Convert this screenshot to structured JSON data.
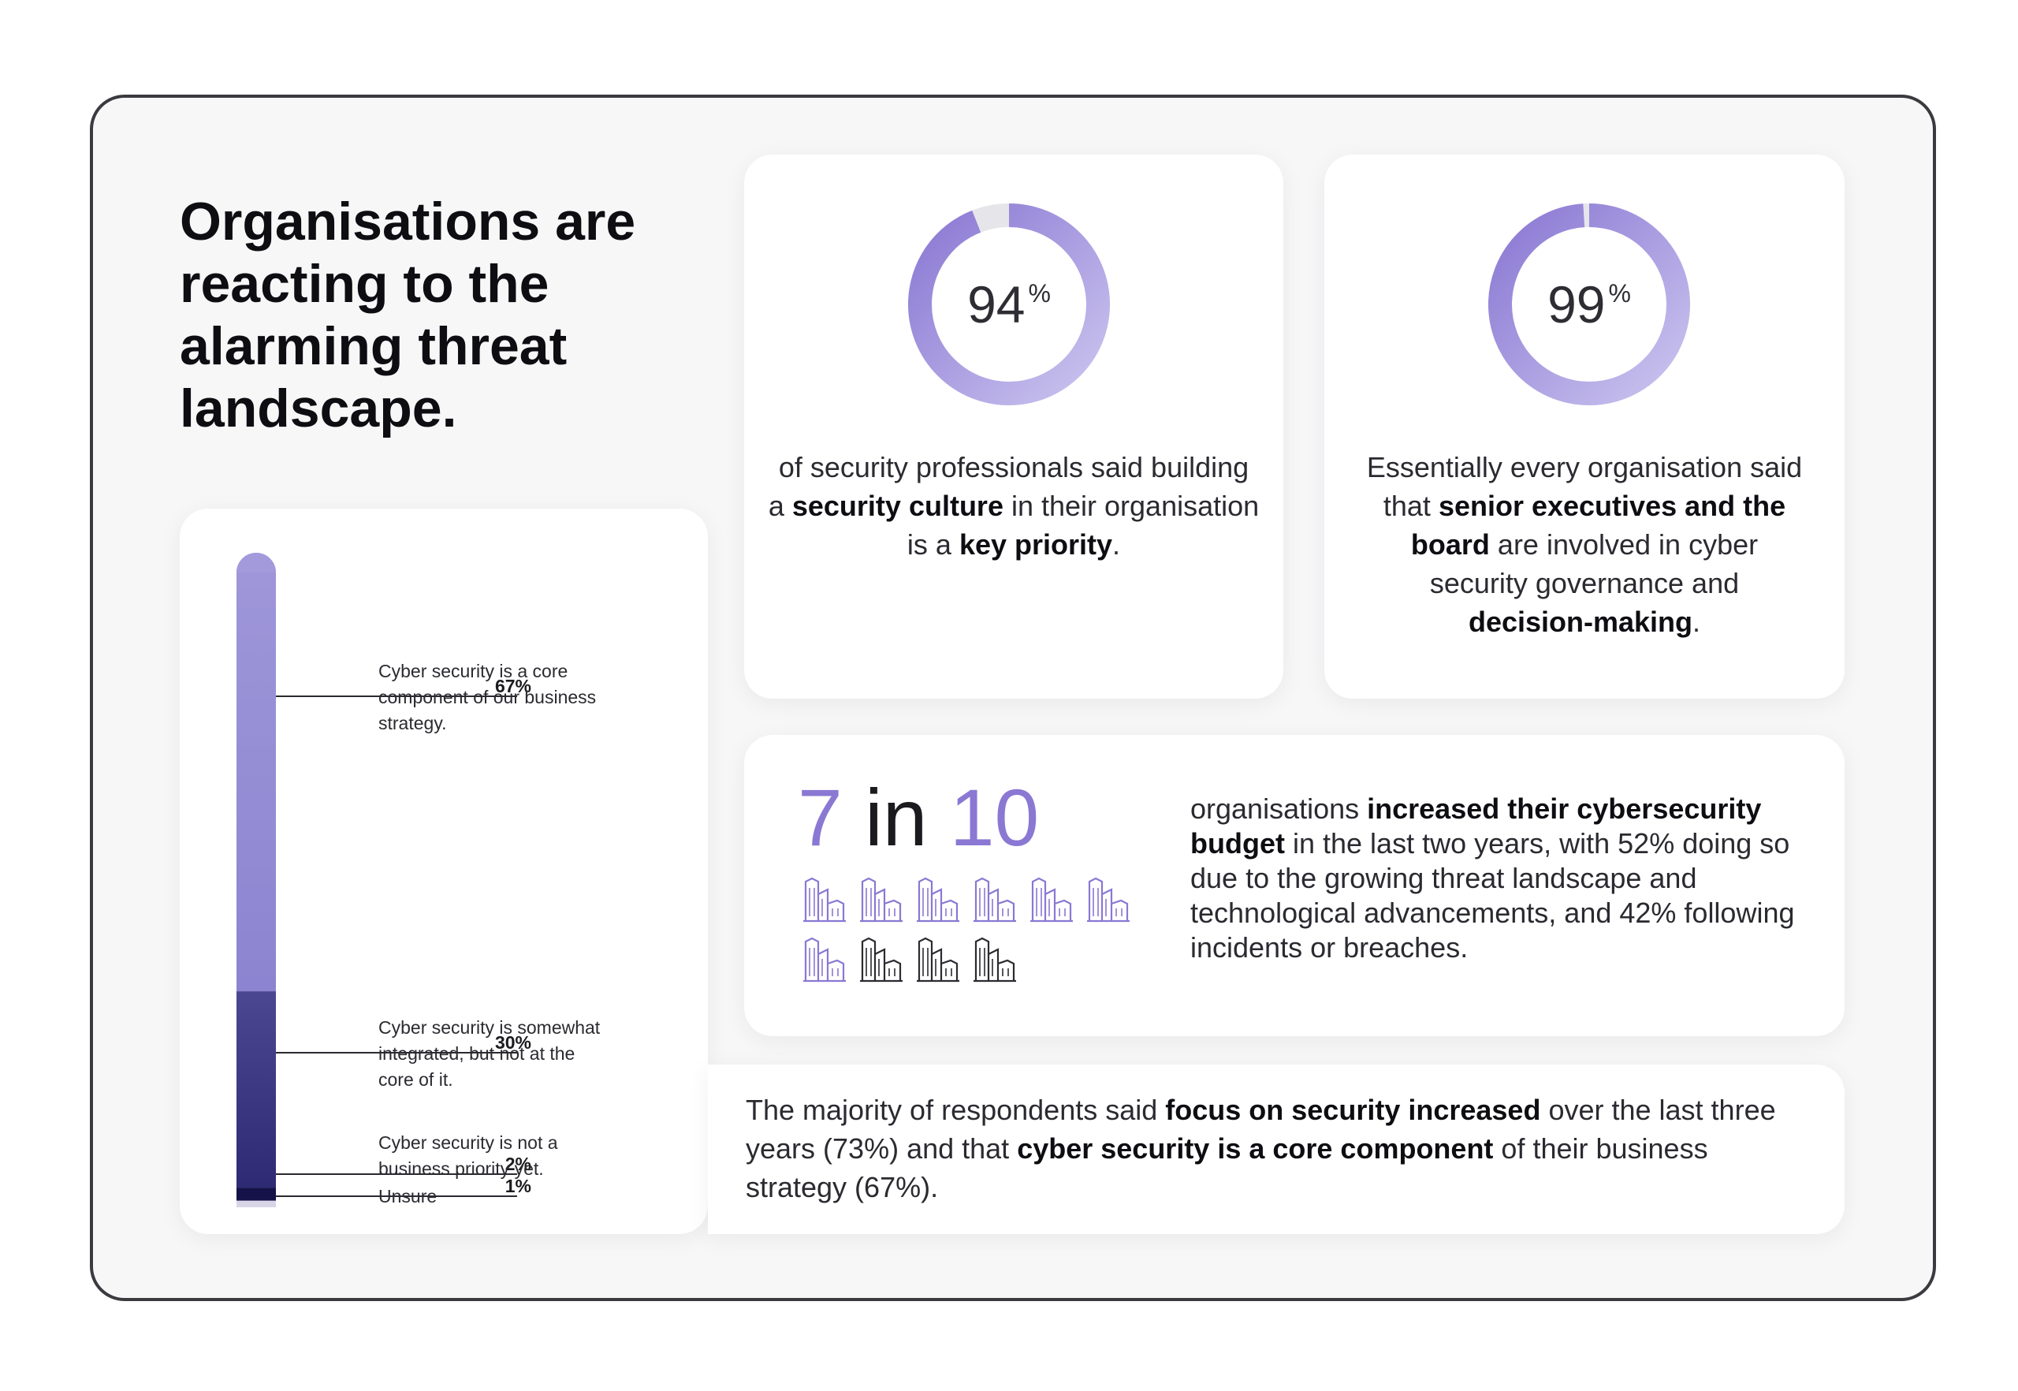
{
  "headline": "Organisations are reacting to the alarming threat landscape.",
  "colors": {
    "light_purple": "#9a90d6",
    "mid_indigo": "#3e3a86",
    "dark_navy": "#15124a",
    "unsure_gray": "#d8d6e6",
    "donut_track": "#e6e6ea",
    "accent": "#8a78d3"
  },
  "chart_data": [
    {
      "type": "bar",
      "orientation": "vertical-stacked",
      "categories": [
        "Cyber security is a core component of our business strategy.",
        "Cyber security is somewhat integrated, but not at the core of it.",
        "Cyber security is not a business priority yet.",
        "Unsure"
      ],
      "values": [
        67,
        30,
        2,
        1
      ],
      "value_labels": [
        "67%",
        "30%",
        "2%",
        "1%"
      ],
      "unit": "%"
    },
    {
      "type": "pie",
      "style": "donut",
      "value": 94,
      "value_label": "94",
      "unit": "%",
      "caption": {
        "t1": "of security professionals said building a ",
        "b1": "security culture",
        "t2": " in their organisation is a ",
        "b2": "key priority",
        "t3": "."
      }
    },
    {
      "type": "pie",
      "style": "donut",
      "value": 99,
      "value_label": "99",
      "unit": "%",
      "caption": {
        "t1": "Essentially every organisation said that ",
        "b1": "senior executives and the board",
        "t2": " are involved in cyber security governance and ",
        "b2": "decision-making",
        "t3": "."
      }
    }
  ],
  "ratio": {
    "numerator": "7",
    "word": "in",
    "denominator": "10",
    "highlighted": 7,
    "total": 10,
    "icon": "building-icon",
    "text": {
      "t1": "organisations ",
      "b1": "increased their cybersecurity budget",
      "t2": " in the last two years, with 52% doing so due to the growing threat landscape and technological advancements, and 42% following incidents or breaches."
    }
  },
  "bottom": {
    "t1": "The majority of respondents said ",
    "b1": "focus on security increased",
    "t2": " over the last three years (73%) and that ",
    "b2": "cyber security is a core component",
    "t3": " of their business strategy (67%)."
  }
}
